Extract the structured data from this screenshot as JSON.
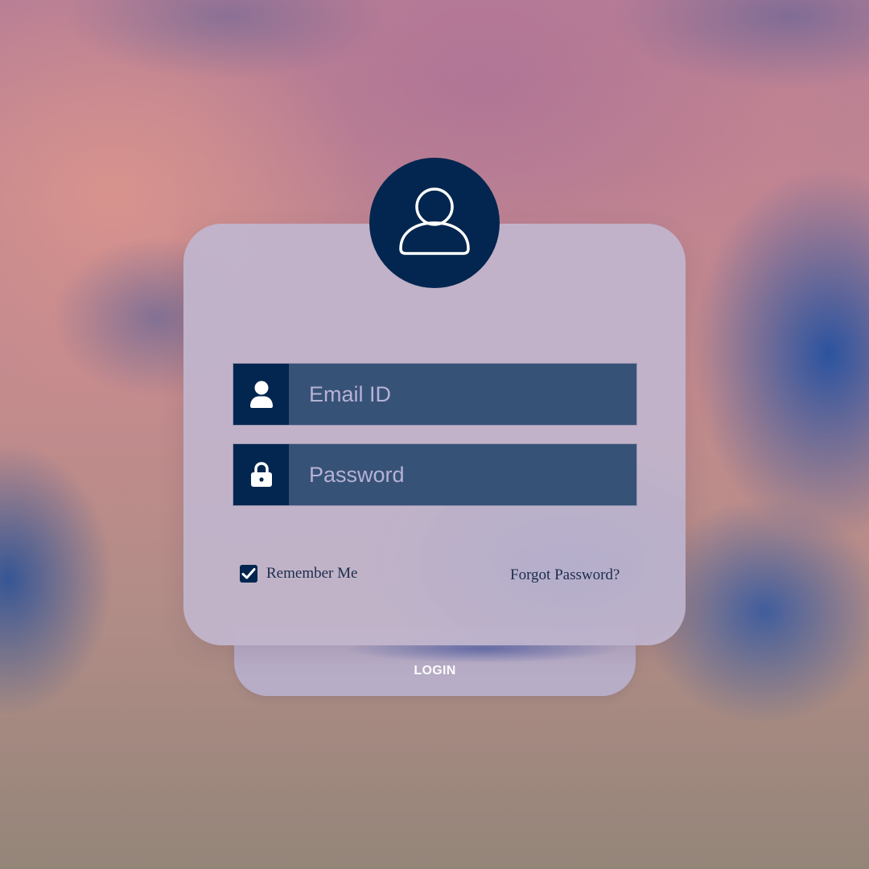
{
  "login_form": {
    "avatar_icon": "user-outline-icon",
    "email": {
      "icon": "user-solid-icon",
      "placeholder": "Email ID",
      "value": ""
    },
    "password": {
      "icon": "lock-icon",
      "placeholder": "Password",
      "value": ""
    },
    "remember_me": {
      "label": "Remember Me",
      "checked": true
    },
    "forgot_password_label": "Forgot Password?",
    "login_button_label": "LOGIN"
  },
  "colors": {
    "navy": "#02264f",
    "input_bg": "#375277",
    "card_bg": "#c1b4cb",
    "text_dark": "#1c2c4c"
  }
}
